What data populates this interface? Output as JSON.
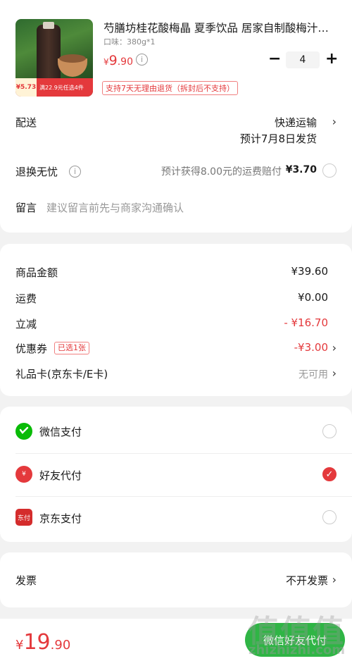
{
  "product": {
    "title": "芍膳坊桂花酸梅晶 夏季饮品 居家自制酸梅汁…",
    "spec": "口味：380g*1",
    "price_symbol": "¥",
    "price_int": "9",
    "price_dec": ".90",
    "quantity": "4",
    "minus": "−",
    "plus": "+",
    "info": "i",
    "return_policy": "支持7天无理由退货（拆封后不支持）",
    "thumb_price": "¥5.73",
    "thumb_promo": "满22.9元任选4件"
  },
  "delivery": {
    "label": "配送",
    "method": "快递运输",
    "eta": "预计7月8日发货"
  },
  "return_insurance": {
    "label": "退换无忧",
    "info": "i",
    "desc": "预计获得8.00元的运费赔付",
    "price": "¥3.70"
  },
  "message": {
    "label": "留言",
    "placeholder": "建议留言前先与商家沟通确认"
  },
  "summary": {
    "goods_label": "商品金额",
    "goods_value": "¥39.60",
    "shipping_label": "运费",
    "shipping_value": "¥0.00",
    "discount_label": "立减",
    "discount_value": "- ¥16.70",
    "coupon_label": "优惠券",
    "coupon_tag": "已选1张",
    "coupon_value": "-¥3.00",
    "giftcard_label": "礼品卡(京东卡/E卡)",
    "giftcard_value": "无可用"
  },
  "payment": {
    "wechat": "微信支付",
    "friend": "好友代付",
    "jd": "京东支付",
    "jd_icon_text": "东付",
    "friend_icon_text": "¥",
    "check": "✓"
  },
  "invoice": {
    "label": "发票",
    "value": "不开发票"
  },
  "footer": {
    "total_symbol": "¥",
    "total_int": "19",
    "total_dec": ".90",
    "pay_button": "微信好友代付"
  },
  "watermark": {
    "chars": "值值值",
    "url": "zhizhizhi.com"
  },
  "colors": {
    "accent": "#e4393c",
    "wechat_green": "#2fb545"
  },
  "chevron": "›"
}
